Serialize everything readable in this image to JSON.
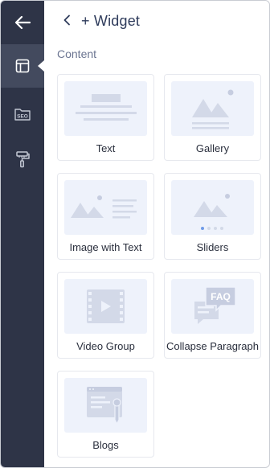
{
  "header": {
    "title": "+ Widget"
  },
  "sidebar": {
    "items": [
      {
        "name": "back",
        "icon": "arrow-left-icon"
      },
      {
        "name": "layout",
        "icon": "layout-icon",
        "active": true
      },
      {
        "name": "seo",
        "icon": "seo-icon",
        "text": "SEO"
      },
      {
        "name": "theme",
        "icon": "paint-roller-icon"
      }
    ]
  },
  "section": {
    "label": "Content"
  },
  "widgets": [
    {
      "label": "Text",
      "icon": "text-widget-icon"
    },
    {
      "label": "Gallery",
      "icon": "gallery-widget-icon"
    },
    {
      "label": "Image with Text",
      "icon": "image-with-text-widget-icon"
    },
    {
      "label": "Sliders",
      "icon": "sliders-widget-icon"
    },
    {
      "label": "Video Group",
      "icon": "video-group-widget-icon"
    },
    {
      "label": "Collapse Paragraph",
      "icon": "collapse-paragraph-widget-icon",
      "badge": "FAQ"
    },
    {
      "label": "Blogs",
      "icon": "blogs-widget-icon"
    }
  ],
  "colors": {
    "sidebar_bg": "#2e3447",
    "sidebar_active": "#434a5e",
    "accent_title": "#2e3b5b",
    "thumb_bg": "#eef2fb",
    "thumb_shape": "#d3d9e8",
    "slider_dot_active": "#6f9be8"
  }
}
